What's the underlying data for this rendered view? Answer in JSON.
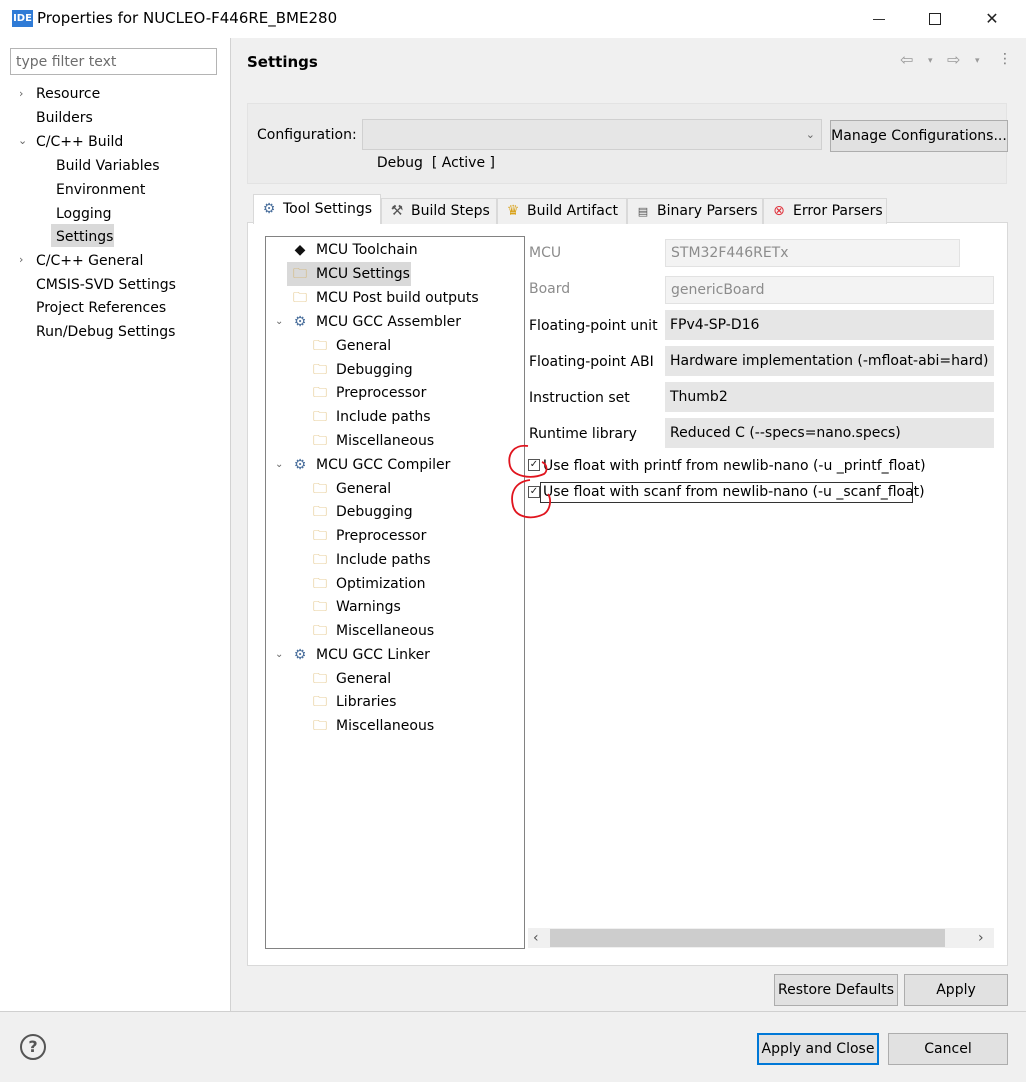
{
  "window": {
    "app_icon_text": "IDE",
    "title": "Properties for NUCLEO-F446RE_BME280"
  },
  "left_nav": {
    "filter_placeholder": "type filter text",
    "items": [
      {
        "label": "Resource",
        "level": 0,
        "expander": "collapsed"
      },
      {
        "label": "Builders",
        "level": 0
      },
      {
        "label": "C/C++ Build",
        "level": 0,
        "expander": "expanded"
      },
      {
        "label": "Build Variables",
        "level": 1
      },
      {
        "label": "Environment",
        "level": 1
      },
      {
        "label": "Logging",
        "level": 1
      },
      {
        "label": "Settings",
        "level": 1,
        "selected": true
      },
      {
        "label": "C/C++ General",
        "level": 0,
        "expander": "collapsed"
      },
      {
        "label": "CMSIS-SVD Settings",
        "level": 0
      },
      {
        "label": "Project References",
        "level": 0
      },
      {
        "label": "Run/Debug Settings",
        "level": 0
      }
    ]
  },
  "page": {
    "title": "Settings",
    "configuration_label": "Configuration:",
    "configuration_value": "Debug  [ Active ]",
    "manage_button": "Manage Configurations..."
  },
  "tabs": [
    {
      "label": "Tool Settings",
      "icon": "gear-icon",
      "active": true
    },
    {
      "label": "Build Steps",
      "icon": "hammer-icon"
    },
    {
      "label": "Build Artifact",
      "icon": "trophy-icon"
    },
    {
      "label": "Binary Parsers",
      "icon": "binary-file-icon"
    },
    {
      "label": "Error Parsers",
      "icon": "error-icon"
    }
  ],
  "tool_tree": [
    {
      "label": "MCU Toolchain",
      "level": 0,
      "icon": "chip-icon"
    },
    {
      "label": "MCU Settings",
      "level": 0,
      "icon": "folder-icon",
      "selected": true
    },
    {
      "label": "MCU Post build outputs",
      "level": 0,
      "icon": "folder-icon"
    },
    {
      "label": "MCU GCC Assembler",
      "level": 0,
      "icon": "gear-icon",
      "expander": "expanded"
    },
    {
      "label": "General",
      "level": 1,
      "icon": "folder-icon"
    },
    {
      "label": "Debugging",
      "level": 1,
      "icon": "folder-icon"
    },
    {
      "label": "Preprocessor",
      "level": 1,
      "icon": "folder-icon"
    },
    {
      "label": "Include paths",
      "level": 1,
      "icon": "folder-icon"
    },
    {
      "label": "Miscellaneous",
      "level": 1,
      "icon": "folder-icon"
    },
    {
      "label": "MCU GCC Compiler",
      "level": 0,
      "icon": "gear-icon",
      "expander": "expanded"
    },
    {
      "label": "General",
      "level": 1,
      "icon": "folder-icon"
    },
    {
      "label": "Debugging",
      "level": 1,
      "icon": "folder-icon"
    },
    {
      "label": "Preprocessor",
      "level": 1,
      "icon": "folder-icon"
    },
    {
      "label": "Include paths",
      "level": 1,
      "icon": "folder-icon"
    },
    {
      "label": "Optimization",
      "level": 1,
      "icon": "folder-icon"
    },
    {
      "label": "Warnings",
      "level": 1,
      "icon": "folder-icon"
    },
    {
      "label": "Miscellaneous",
      "level": 1,
      "icon": "folder-icon"
    },
    {
      "label": "MCU GCC Linker",
      "level": 0,
      "icon": "gear-icon",
      "expander": "expanded"
    },
    {
      "label": "General",
      "level": 1,
      "icon": "folder-icon"
    },
    {
      "label": "Libraries",
      "level": 1,
      "icon": "folder-icon"
    },
    {
      "label": "Miscellaneous",
      "level": 1,
      "icon": "folder-icon"
    }
  ],
  "properties": [
    {
      "label": "MCU",
      "value": "STM32F446RETx",
      "disabled": true
    },
    {
      "label": "Board",
      "value": "genericBoard",
      "disabled": true
    },
    {
      "label": "Floating-point unit",
      "value": "FPv4-SP-D16"
    },
    {
      "label": "Floating-point ABI",
      "value": "Hardware implementation (-mfloat-abi=hard)"
    },
    {
      "label": "Instruction set",
      "value": "Thumb2"
    },
    {
      "label": "Runtime library",
      "value": "Reduced C (--specs=nano.specs)"
    }
  ],
  "checkboxes": [
    {
      "label": "Use float with printf from newlib-nano (-u _printf_float)",
      "checked": true
    },
    {
      "label": "Use float with scanf from newlib-nano (-u _scanf_float)",
      "checked": true
    }
  ],
  "buttons": {
    "restore_defaults": "Restore Defaults",
    "apply": "Apply",
    "apply_and_close": "Apply and Close",
    "cancel": "Cancel"
  },
  "colors": {
    "annotation": "#e0141e",
    "default_button_border": "#0078d7"
  }
}
